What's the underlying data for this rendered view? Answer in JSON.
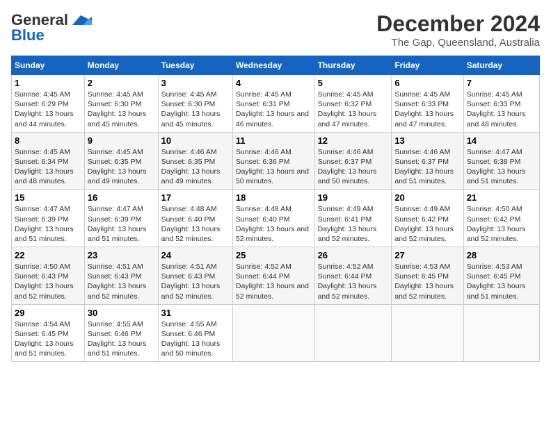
{
  "header": {
    "logo_line1": "General",
    "logo_line2": "Blue",
    "month": "December 2024",
    "location": "The Gap, Queensland, Australia"
  },
  "columns": [
    "Sunday",
    "Monday",
    "Tuesday",
    "Wednesday",
    "Thursday",
    "Friday",
    "Saturday"
  ],
  "weeks": [
    [
      {
        "day": "1",
        "sunrise": "Sunrise: 4:45 AM",
        "sunset": "Sunset: 6:29 PM",
        "daylight": "Daylight: 13 hours and 44 minutes."
      },
      {
        "day": "2",
        "sunrise": "Sunrise: 4:45 AM",
        "sunset": "Sunset: 6:30 PM",
        "daylight": "Daylight: 13 hours and 45 minutes."
      },
      {
        "day": "3",
        "sunrise": "Sunrise: 4:45 AM",
        "sunset": "Sunset: 6:30 PM",
        "daylight": "Daylight: 13 hours and 45 minutes."
      },
      {
        "day": "4",
        "sunrise": "Sunrise: 4:45 AM",
        "sunset": "Sunset: 6:31 PM",
        "daylight": "Daylight: 13 hours and 46 minutes."
      },
      {
        "day": "5",
        "sunrise": "Sunrise: 4:45 AM",
        "sunset": "Sunset: 6:32 PM",
        "daylight": "Daylight: 13 hours and 47 minutes."
      },
      {
        "day": "6",
        "sunrise": "Sunrise: 4:45 AM",
        "sunset": "Sunset: 6:33 PM",
        "daylight": "Daylight: 13 hours and 47 minutes."
      },
      {
        "day": "7",
        "sunrise": "Sunrise: 4:45 AM",
        "sunset": "Sunset: 6:33 PM",
        "daylight": "Daylight: 13 hours and 48 minutes."
      }
    ],
    [
      {
        "day": "8",
        "sunrise": "Sunrise: 4:45 AM",
        "sunset": "Sunset: 6:34 PM",
        "daylight": "Daylight: 13 hours and 48 minutes."
      },
      {
        "day": "9",
        "sunrise": "Sunrise: 4:45 AM",
        "sunset": "Sunset: 6:35 PM",
        "daylight": "Daylight: 13 hours and 49 minutes."
      },
      {
        "day": "10",
        "sunrise": "Sunrise: 4:46 AM",
        "sunset": "Sunset: 6:35 PM",
        "daylight": "Daylight: 13 hours and 49 minutes."
      },
      {
        "day": "11",
        "sunrise": "Sunrise: 4:46 AM",
        "sunset": "Sunset: 6:36 PM",
        "daylight": "Daylight: 13 hours and 50 minutes."
      },
      {
        "day": "12",
        "sunrise": "Sunrise: 4:46 AM",
        "sunset": "Sunset: 6:37 PM",
        "daylight": "Daylight: 13 hours and 50 minutes."
      },
      {
        "day": "13",
        "sunrise": "Sunrise: 4:46 AM",
        "sunset": "Sunset: 6:37 PM",
        "daylight": "Daylight: 13 hours and 51 minutes."
      },
      {
        "day": "14",
        "sunrise": "Sunrise: 4:47 AM",
        "sunset": "Sunset: 6:38 PM",
        "daylight": "Daylight: 13 hours and 51 minutes."
      }
    ],
    [
      {
        "day": "15",
        "sunrise": "Sunrise: 4:47 AM",
        "sunset": "Sunset: 6:39 PM",
        "daylight": "Daylight: 13 hours and 51 minutes."
      },
      {
        "day": "16",
        "sunrise": "Sunrise: 4:47 AM",
        "sunset": "Sunset: 6:39 PM",
        "daylight": "Daylight: 13 hours and 51 minutes."
      },
      {
        "day": "17",
        "sunrise": "Sunrise: 4:48 AM",
        "sunset": "Sunset: 6:40 PM",
        "daylight": "Daylight: 13 hours and 52 minutes."
      },
      {
        "day": "18",
        "sunrise": "Sunrise: 4:48 AM",
        "sunset": "Sunset: 6:40 PM",
        "daylight": "Daylight: 13 hours and 52 minutes."
      },
      {
        "day": "19",
        "sunrise": "Sunrise: 4:49 AM",
        "sunset": "Sunset: 6:41 PM",
        "daylight": "Daylight: 13 hours and 52 minutes."
      },
      {
        "day": "20",
        "sunrise": "Sunrise: 4:49 AM",
        "sunset": "Sunset: 6:42 PM",
        "daylight": "Daylight: 13 hours and 52 minutes."
      },
      {
        "day": "21",
        "sunrise": "Sunrise: 4:50 AM",
        "sunset": "Sunset: 6:42 PM",
        "daylight": "Daylight: 13 hours and 52 minutes."
      }
    ],
    [
      {
        "day": "22",
        "sunrise": "Sunrise: 4:50 AM",
        "sunset": "Sunset: 6:43 PM",
        "daylight": "Daylight: 13 hours and 52 minutes."
      },
      {
        "day": "23",
        "sunrise": "Sunrise: 4:51 AM",
        "sunset": "Sunset: 6:43 PM",
        "daylight": "Daylight: 13 hours and 52 minutes."
      },
      {
        "day": "24",
        "sunrise": "Sunrise: 4:51 AM",
        "sunset": "Sunset: 6:43 PM",
        "daylight": "Daylight: 13 hours and 52 minutes."
      },
      {
        "day": "25",
        "sunrise": "Sunrise: 4:52 AM",
        "sunset": "Sunset: 6:44 PM",
        "daylight": "Daylight: 13 hours and 52 minutes."
      },
      {
        "day": "26",
        "sunrise": "Sunrise: 4:52 AM",
        "sunset": "Sunset: 6:44 PM",
        "daylight": "Daylight: 13 hours and 52 minutes."
      },
      {
        "day": "27",
        "sunrise": "Sunrise: 4:53 AM",
        "sunset": "Sunset: 6:45 PM",
        "daylight": "Daylight: 13 hours and 52 minutes."
      },
      {
        "day": "28",
        "sunrise": "Sunrise: 4:53 AM",
        "sunset": "Sunset: 6:45 PM",
        "daylight": "Daylight: 13 hours and 51 minutes."
      }
    ],
    [
      {
        "day": "29",
        "sunrise": "Sunrise: 4:54 AM",
        "sunset": "Sunset: 6:45 PM",
        "daylight": "Daylight: 13 hours and 51 minutes."
      },
      {
        "day": "30",
        "sunrise": "Sunrise: 4:55 AM",
        "sunset": "Sunset: 6:46 PM",
        "daylight": "Daylight: 13 hours and 51 minutes."
      },
      {
        "day": "31",
        "sunrise": "Sunrise: 4:55 AM",
        "sunset": "Sunset: 6:46 PM",
        "daylight": "Daylight: 13 hours and 50 minutes."
      },
      null,
      null,
      null,
      null
    ]
  ]
}
